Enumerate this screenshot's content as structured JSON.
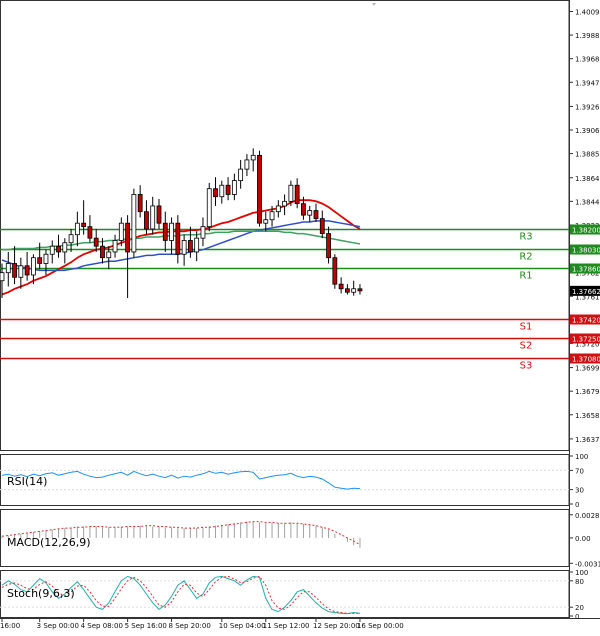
{
  "chart_data": {
    "type": "candlestick",
    "title": "",
    "main": {
      "ylim": [
        1.3627,
        1.4019
      ],
      "y_ticks": [
        "1.40090",
        "1.39885",
        "1.39680",
        "1.39475",
        "1.39265",
        "1.39060",
        "1.38855",
        "1.38645",
        "1.38440",
        "1.38235",
        "1.38030",
        "1.37820",
        "1.37615",
        "1.37410",
        "1.37205",
        "1.36995",
        "1.36790",
        "1.36585",
        "1.36375"
      ],
      "current_price": "1.37662",
      "candles": [
        {
          "o": 1.3775,
          "h": 1.379,
          "l": 1.376,
          "c": 1.3782
        },
        {
          "o": 1.3782,
          "h": 1.38,
          "l": 1.377,
          "c": 1.379
        },
        {
          "o": 1.379,
          "h": 1.3805,
          "l": 1.3772,
          "c": 1.3778
        },
        {
          "o": 1.3778,
          "h": 1.3795,
          "l": 1.3768,
          "c": 1.3788
        },
        {
          "o": 1.3788,
          "h": 1.38,
          "l": 1.3775,
          "c": 1.378
        },
        {
          "o": 1.378,
          "h": 1.3798,
          "l": 1.3772,
          "c": 1.3795
        },
        {
          "o": 1.3795,
          "h": 1.3808,
          "l": 1.3785,
          "c": 1.379
        },
        {
          "o": 1.379,
          "h": 1.3802,
          "l": 1.378,
          "c": 1.3798
        },
        {
          "o": 1.3798,
          "h": 1.381,
          "l": 1.379,
          "c": 1.3805
        },
        {
          "o": 1.3805,
          "h": 1.3815,
          "l": 1.3795,
          "c": 1.38
        },
        {
          "o": 1.38,
          "h": 1.3812,
          "l": 1.379,
          "c": 1.3808
        },
        {
          "o": 1.3808,
          "h": 1.382,
          "l": 1.38,
          "c": 1.3815
        },
        {
          "o": 1.3815,
          "h": 1.3835,
          "l": 1.3805,
          "c": 1.3825
        },
        {
          "o": 1.3825,
          "h": 1.3845,
          "l": 1.3815,
          "c": 1.3822
        },
        {
          "o": 1.3822,
          "h": 1.3832,
          "l": 1.3808,
          "c": 1.3812
        },
        {
          "o": 1.3812,
          "h": 1.382,
          "l": 1.38,
          "c": 1.3805
        },
        {
          "o": 1.3805,
          "h": 1.3812,
          "l": 1.379,
          "c": 1.3795
        },
        {
          "o": 1.3795,
          "h": 1.3805,
          "l": 1.3785,
          "c": 1.38
        },
        {
          "o": 1.38,
          "h": 1.3815,
          "l": 1.3795,
          "c": 1.381
        },
        {
          "o": 1.381,
          "h": 1.383,
          "l": 1.3805,
          "c": 1.3825
        },
        {
          "o": 1.3825,
          "h": 1.3832,
          "l": 1.376,
          "c": 1.38
        },
        {
          "o": 1.38,
          "h": 1.3855,
          "l": 1.3795,
          "c": 1.385
        },
        {
          "o": 1.385,
          "h": 1.3858,
          "l": 1.383,
          "c": 1.3835
        },
        {
          "o": 1.3835,
          "h": 1.3845,
          "l": 1.3815,
          "c": 1.382
        },
        {
          "o": 1.382,
          "h": 1.3848,
          "l": 1.3815,
          "c": 1.384
        },
        {
          "o": 1.384,
          "h": 1.3846,
          "l": 1.382,
          "c": 1.3825
        },
        {
          "o": 1.3825,
          "h": 1.3835,
          "l": 1.38,
          "c": 1.381
        },
        {
          "o": 1.381,
          "h": 1.383,
          "l": 1.3798,
          "c": 1.3825
        },
        {
          "o": 1.3825,
          "h": 1.3832,
          "l": 1.379,
          "c": 1.3798
        },
        {
          "o": 1.3798,
          "h": 1.3815,
          "l": 1.3788,
          "c": 1.381
        },
        {
          "o": 1.381,
          "h": 1.3822,
          "l": 1.3795,
          "c": 1.38
        },
        {
          "o": 1.38,
          "h": 1.3818,
          "l": 1.3792,
          "c": 1.3812
        },
        {
          "o": 1.3812,
          "h": 1.383,
          "l": 1.3805,
          "c": 1.3822
        },
        {
          "o": 1.3822,
          "h": 1.386,
          "l": 1.3818,
          "c": 1.3855
        },
        {
          "o": 1.3855,
          "h": 1.3865,
          "l": 1.384,
          "c": 1.3848
        },
        {
          "o": 1.3848,
          "h": 1.3862,
          "l": 1.3842,
          "c": 1.3858
        },
        {
          "o": 1.3858,
          "h": 1.3865,
          "l": 1.3845,
          "c": 1.385
        },
        {
          "o": 1.385,
          "h": 1.3868,
          "l": 1.3845,
          "c": 1.3862
        },
        {
          "o": 1.3862,
          "h": 1.388,
          "l": 1.3855,
          "c": 1.3872
        },
        {
          "o": 1.3872,
          "h": 1.3885,
          "l": 1.3866,
          "c": 1.388
        },
        {
          "o": 1.388,
          "h": 1.389,
          "l": 1.387,
          "c": 1.3884
        },
        {
          "o": 1.3884,
          "h": 1.3888,
          "l": 1.3822,
          "c": 1.3825
        },
        {
          "o": 1.3825,
          "h": 1.3835,
          "l": 1.3818,
          "c": 1.3828
        },
        {
          "o": 1.3828,
          "h": 1.384,
          "l": 1.3822,
          "c": 1.3835
        },
        {
          "o": 1.3835,
          "h": 1.3845,
          "l": 1.383,
          "c": 1.384
        },
        {
          "o": 1.384,
          "h": 1.385,
          "l": 1.3832,
          "c": 1.3844
        },
        {
          "o": 1.3844,
          "h": 1.3862,
          "l": 1.384,
          "c": 1.3858
        },
        {
          "o": 1.3858,
          "h": 1.3864,
          "l": 1.3838,
          "c": 1.3842
        },
        {
          "o": 1.3842,
          "h": 1.3848,
          "l": 1.3828,
          "c": 1.3832
        },
        {
          "o": 1.3832,
          "h": 1.384,
          "l": 1.3826,
          "c": 1.3836
        },
        {
          "o": 1.3836,
          "h": 1.3842,
          "l": 1.3826,
          "c": 1.3829
        },
        {
          "o": 1.3829,
          "h": 1.3836,
          "l": 1.3812,
          "c": 1.3816
        },
        {
          "o": 1.3816,
          "h": 1.3822,
          "l": 1.379,
          "c": 1.3795
        },
        {
          "o": 1.3795,
          "h": 1.3798,
          "l": 1.3768,
          "c": 1.3772
        },
        {
          "o": 1.3772,
          "h": 1.3778,
          "l": 1.3764,
          "c": 1.3768
        },
        {
          "o": 1.3768,
          "h": 1.3772,
          "l": 1.3763,
          "c": 1.3765
        },
        {
          "o": 1.3765,
          "h": 1.3775,
          "l": 1.3762,
          "c": 1.3768
        },
        {
          "o": 1.3768,
          "h": 1.3772,
          "l": 1.3763,
          "c": 1.37662
        }
      ],
      "moving_averages": [
        {
          "name": "fast",
          "color": "#e00000",
          "values": [
            1.3763,
            1.3765,
            1.3768,
            1.377,
            1.3772,
            1.3775,
            1.3777,
            1.3779,
            1.3782,
            1.3785,
            1.3788,
            1.3791,
            1.3795,
            1.3798,
            1.38,
            1.3802,
            1.3803,
            1.3804,
            1.3806,
            1.3808,
            1.381,
            1.3812,
            1.3814,
            1.3815,
            1.3816,
            1.3817,
            1.3817,
            1.3818,
            1.3818,
            1.3818,
            1.3819,
            1.3819,
            1.382,
            1.3821,
            1.3823,
            1.3825,
            1.3826,
            1.3828,
            1.383,
            1.3832,
            1.3834,
            1.3835,
            1.3836,
            1.3837,
            1.3838,
            1.384,
            1.3843,
            1.3845,
            1.3845,
            1.3845,
            1.3844,
            1.3842,
            1.3839,
            1.3835,
            1.3831,
            1.3827,
            1.3823,
            1.382
          ]
        },
        {
          "name": "mid",
          "color": "#3050c0",
          "values": [
            1.3793,
            1.3791,
            1.3789,
            1.3787,
            1.3786,
            1.3785,
            1.3784,
            1.3784,
            1.3784,
            1.3784,
            1.3784,
            1.3785,
            1.3786,
            1.3788,
            1.3789,
            1.379,
            1.3791,
            1.3792,
            1.3792,
            1.3793,
            1.3794,
            1.3795,
            1.3796,
            1.3797,
            1.3797,
            1.3798,
            1.3798,
            1.3798,
            1.3798,
            1.3799,
            1.38,
            1.3801,
            1.3802,
            1.3804,
            1.3806,
            1.3808,
            1.381,
            1.3812,
            1.3814,
            1.3816,
            1.3818,
            1.3819,
            1.382,
            1.3821,
            1.3822,
            1.3823,
            1.3824,
            1.3825,
            1.3826,
            1.3826,
            1.3827,
            1.3827,
            1.3827,
            1.3826,
            1.3825,
            1.3824,
            1.3823,
            1.3822
          ]
        },
        {
          "name": "slow",
          "color": "#40a060",
          "values": [
            1.3802,
            1.3802,
            1.3803,
            1.3803,
            1.3803,
            1.3803,
            1.3804,
            1.3804,
            1.3805,
            1.3805,
            1.3806,
            1.3806,
            1.3807,
            1.3808,
            1.3808,
            1.3809,
            1.3809,
            1.381,
            1.381,
            1.3811,
            1.3811,
            1.3812,
            1.3812,
            1.3813,
            1.3813,
            1.3813,
            1.3814,
            1.3814,
            1.3814,
            1.3815,
            1.3815,
            1.3815,
            1.3816,
            1.3816,
            1.3817,
            1.3817,
            1.3817,
            1.3818,
            1.3818,
            1.3818,
            1.3818,
            1.3818,
            1.3818,
            1.3818,
            1.3818,
            1.3817,
            1.3817,
            1.3816,
            1.3816,
            1.3815,
            1.3814,
            1.3813,
            1.3812,
            1.3811,
            1.381,
            1.3809,
            1.3808,
            1.3807
          ]
        }
      ],
      "levels": [
        {
          "label": "R3",
          "value": "1.38200",
          "v": 1.382,
          "color": "#1f8a1f",
          "bg": "#1f8a1f"
        },
        {
          "label": "R2",
          "value": "1.38030",
          "v": 1.3803,
          "color": "#1f8a1f",
          "bg": "#1f8a1f"
        },
        {
          "label": "R1",
          "value": "1.37860",
          "v": 1.3786,
          "color": "#1f8a1f",
          "bg": "#1f8a1f"
        },
        {
          "label": "S1",
          "value": "1.37420",
          "v": 1.3742,
          "color": "#d01010",
          "bg": "#d01010"
        },
        {
          "label": "S2",
          "value": "1.37250",
          "v": 1.3725,
          "color": "#d01010",
          "bg": "#d01010"
        },
        {
          "label": "S3",
          "value": "1.37080",
          "v": 1.3708,
          "color": "#d01010",
          "bg": "#d01010"
        }
      ],
      "colors": {
        "bull": "#ffffff",
        "bear": "#c00000",
        "wick": "#000000"
      }
    },
    "rsi": {
      "label": "RSI(14)",
      "ylim": [
        0,
        100
      ],
      "ticks": [
        "100",
        "70",
        "30",
        "0"
      ],
      "tick_values": [
        100,
        70,
        30,
        0
      ],
      "color": "#1e90ff",
      "values": [
        60,
        62,
        58,
        61,
        57,
        62,
        59,
        63,
        65,
        60,
        63,
        66,
        68,
        62,
        58,
        55,
        56,
        60,
        63,
        66,
        60,
        68,
        63,
        59,
        62,
        58,
        55,
        60,
        54,
        58,
        56,
        60,
        63,
        68,
        64,
        66,
        62,
        65,
        67,
        68,
        66,
        52,
        55,
        58,
        60,
        61,
        64,
        58,
        55,
        58,
        56,
        52,
        44,
        35,
        33,
        31,
        33,
        32
      ]
    },
    "macd": {
      "label": "MACD(12,26,9)",
      "ylim": [
        -0.00331,
        0.00329
      ],
      "ticks": [
        "0.002829",
        "0.00",
        "-0.003103"
      ],
      "tick_values": [
        0.002829,
        0.0,
        -0.003103
      ],
      "bar_color": "#a0a0a0",
      "signal_color": "#e03030",
      "histogram": [
        0.0002,
        0.0003,
        0.0004,
        0.0005,
        0.0006,
        0.0007,
        0.0008,
        0.0009,
        0.001,
        0.0011,
        0.0012,
        0.0013,
        0.0014,
        0.0014,
        0.0014,
        0.0014,
        0.0013,
        0.0013,
        0.0013,
        0.0014,
        0.0014,
        0.0015,
        0.0015,
        0.0015,
        0.0014,
        0.0014,
        0.0013,
        0.0013,
        0.0012,
        0.0012,
        0.0012,
        0.0012,
        0.0013,
        0.0014,
        0.0015,
        0.0016,
        0.0017,
        0.0018,
        0.0019,
        0.002,
        0.002,
        0.0019,
        0.0018,
        0.0018,
        0.0018,
        0.0018,
        0.0019,
        0.0018,
        0.0017,
        0.0016,
        0.0015,
        0.0013,
        0.001,
        0.0005,
        0.0,
        -0.0005,
        -0.0009,
        -0.0012
      ],
      "signal": [
        0.0002,
        0.0003,
        0.0004,
        0.0005,
        0.0006,
        0.0007,
        0.0008,
        0.0009,
        0.001,
        0.0011,
        0.0012,
        0.0012,
        0.0013,
        0.0013,
        0.0014,
        0.0014,
        0.0014,
        0.0013,
        0.0013,
        0.0013,
        0.0014,
        0.0014,
        0.0014,
        0.0015,
        0.0015,
        0.0014,
        0.0014,
        0.0013,
        0.0013,
        0.0012,
        0.0012,
        0.0012,
        0.0013,
        0.0013,
        0.0014,
        0.0015,
        0.0016,
        0.0017,
        0.0018,
        0.0019,
        0.002,
        0.002,
        0.0019,
        0.0019,
        0.0018,
        0.0018,
        0.0018,
        0.0018,
        0.0017,
        0.0016,
        0.0015,
        0.0013,
        0.0011,
        0.0008,
        0.0004,
        0.0,
        -0.0004,
        -0.0008
      ]
    },
    "stoch": {
      "label": "Stoch(9,6,3)",
      "ylim": [
        0,
        100
      ],
      "ticks": [
        "100",
        "80",
        "20",
        "0"
      ],
      "tick_values": [
        100,
        80,
        20,
        0
      ],
      "main_color": "#20b0b0",
      "signal_color": "#e03030",
      "main": [
        70,
        80,
        72,
        60,
        55,
        70,
        85,
        75,
        55,
        40,
        50,
        65,
        78,
        60,
        40,
        20,
        15,
        30,
        55,
        80,
        90,
        85,
        70,
        50,
        30,
        15,
        25,
        45,
        70,
        80,
        60,
        40,
        50,
        75,
        88,
        90,
        85,
        80,
        70,
        82,
        90,
        88,
        40,
        15,
        10,
        20,
        35,
        55,
        60,
        45,
        30,
        18,
        10,
        8,
        6,
        5,
        8,
        6
      ],
      "signal": [
        65,
        72,
        75,
        70,
        62,
        60,
        72,
        78,
        68,
        52,
        46,
        55,
        68,
        70,
        55,
        35,
        22,
        22,
        40,
        62,
        80,
        88,
        80,
        65,
        45,
        25,
        20,
        32,
        55,
        72,
        70,
        52,
        44,
        60,
        78,
        88,
        90,
        84,
        76,
        78,
        86,
        90,
        70,
        35,
        18,
        15,
        25,
        42,
        55,
        55,
        42,
        28,
        16,
        10,
        8,
        6,
        6,
        6
      ]
    },
    "x_labels": [
      {
        "i": 0,
        "label": "16:00"
      },
      {
        "i": 6,
        "label": "3 Sep 00:00"
      },
      {
        "i": 13,
        "label": "4 Sep 08:00"
      },
      {
        "i": 20,
        "label": "5 Sep 16:00"
      },
      {
        "i": 27,
        "label": "8 Sep 20:00"
      },
      {
        "i": 35,
        "label": "10 Sep 04:00"
      },
      {
        "i": 42,
        "label": "11 Sep 12:00"
      },
      {
        "i": 50,
        "label": "12 Sep 20:00"
      },
      {
        "i": 57,
        "label": "16 Sep 00:00"
      }
    ]
  }
}
